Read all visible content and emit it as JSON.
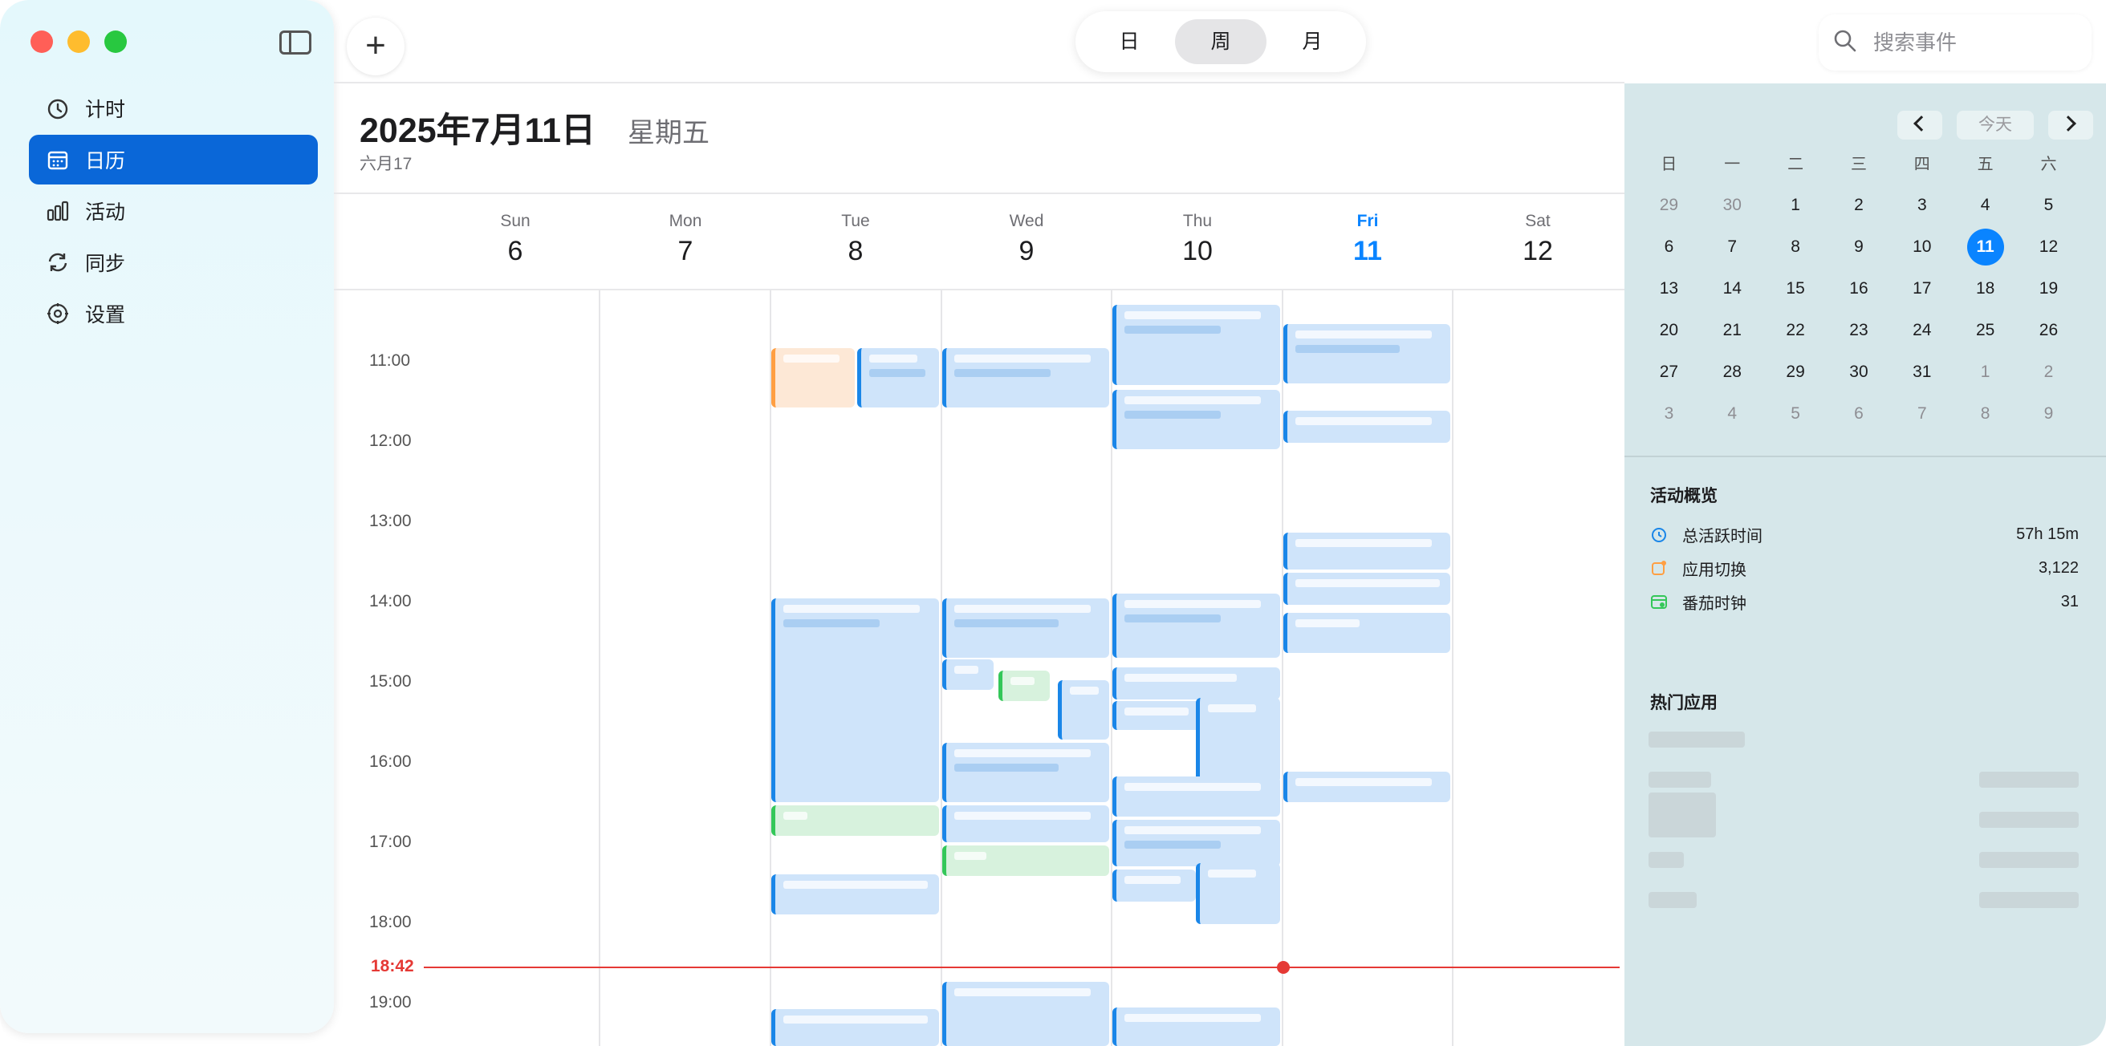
{
  "sidebar": {
    "items": [
      {
        "label": "计时",
        "icon": "timer-icon"
      },
      {
        "label": "日历",
        "icon": "calendar-icon",
        "active": true
      },
      {
        "label": "活动",
        "icon": "bar-chart-icon"
      },
      {
        "label": "同步",
        "icon": "sync-icon"
      },
      {
        "label": "设置",
        "icon": "gear-icon"
      }
    ]
  },
  "toolbar": {
    "add_label": "+",
    "views": [
      "日",
      "周",
      "月"
    ],
    "active_view": "周",
    "search_placeholder": "搜索事件"
  },
  "header": {
    "date": "2025年7月11日",
    "weekday": "星期五",
    "lunar": "六月17"
  },
  "week": {
    "days": [
      {
        "name": "Sun",
        "num": "6"
      },
      {
        "name": "Mon",
        "num": "7"
      },
      {
        "name": "Tue",
        "num": "8"
      },
      {
        "name": "Wed",
        "num": "9"
      },
      {
        "name": "Thu",
        "num": "10"
      },
      {
        "name": "Fri",
        "num": "11",
        "today": true
      },
      {
        "name": "Sat",
        "num": "12"
      }
    ],
    "hours": [
      "11:00",
      "12:00",
      "13:00",
      "14:00",
      "15:00",
      "16:00",
      "17:00",
      "18:00",
      "19:00"
    ],
    "now_label": "18:42"
  },
  "mini_calendar": {
    "today_label": "今天",
    "weekdays": [
      "日",
      "一",
      "二",
      "三",
      "四",
      "五",
      "六"
    ],
    "weeks": [
      [
        "29",
        "30",
        "1",
        "2",
        "3",
        "4",
        "5"
      ],
      [
        "6",
        "7",
        "8",
        "9",
        "10",
        "11",
        "12"
      ],
      [
        "13",
        "14",
        "15",
        "16",
        "17",
        "18",
        "19"
      ],
      [
        "20",
        "21",
        "22",
        "23",
        "24",
        "25",
        "26"
      ],
      [
        "27",
        "28",
        "29",
        "30",
        "31",
        "1",
        "2"
      ],
      [
        "3",
        "4",
        "5",
        "6",
        "7",
        "8",
        "9"
      ]
    ],
    "selected": "11"
  },
  "activity": {
    "title": "活动概览",
    "stats": [
      {
        "label": "总活跃时间",
        "value": "57h 15m",
        "color": "#1a86e8"
      },
      {
        "label": "应用切换",
        "value": "3,122",
        "color": "#ff9f43"
      },
      {
        "label": "番茄时钟",
        "value": "31",
        "color": "#34c759"
      }
    ]
  },
  "top_apps": {
    "title": "热门应用"
  }
}
